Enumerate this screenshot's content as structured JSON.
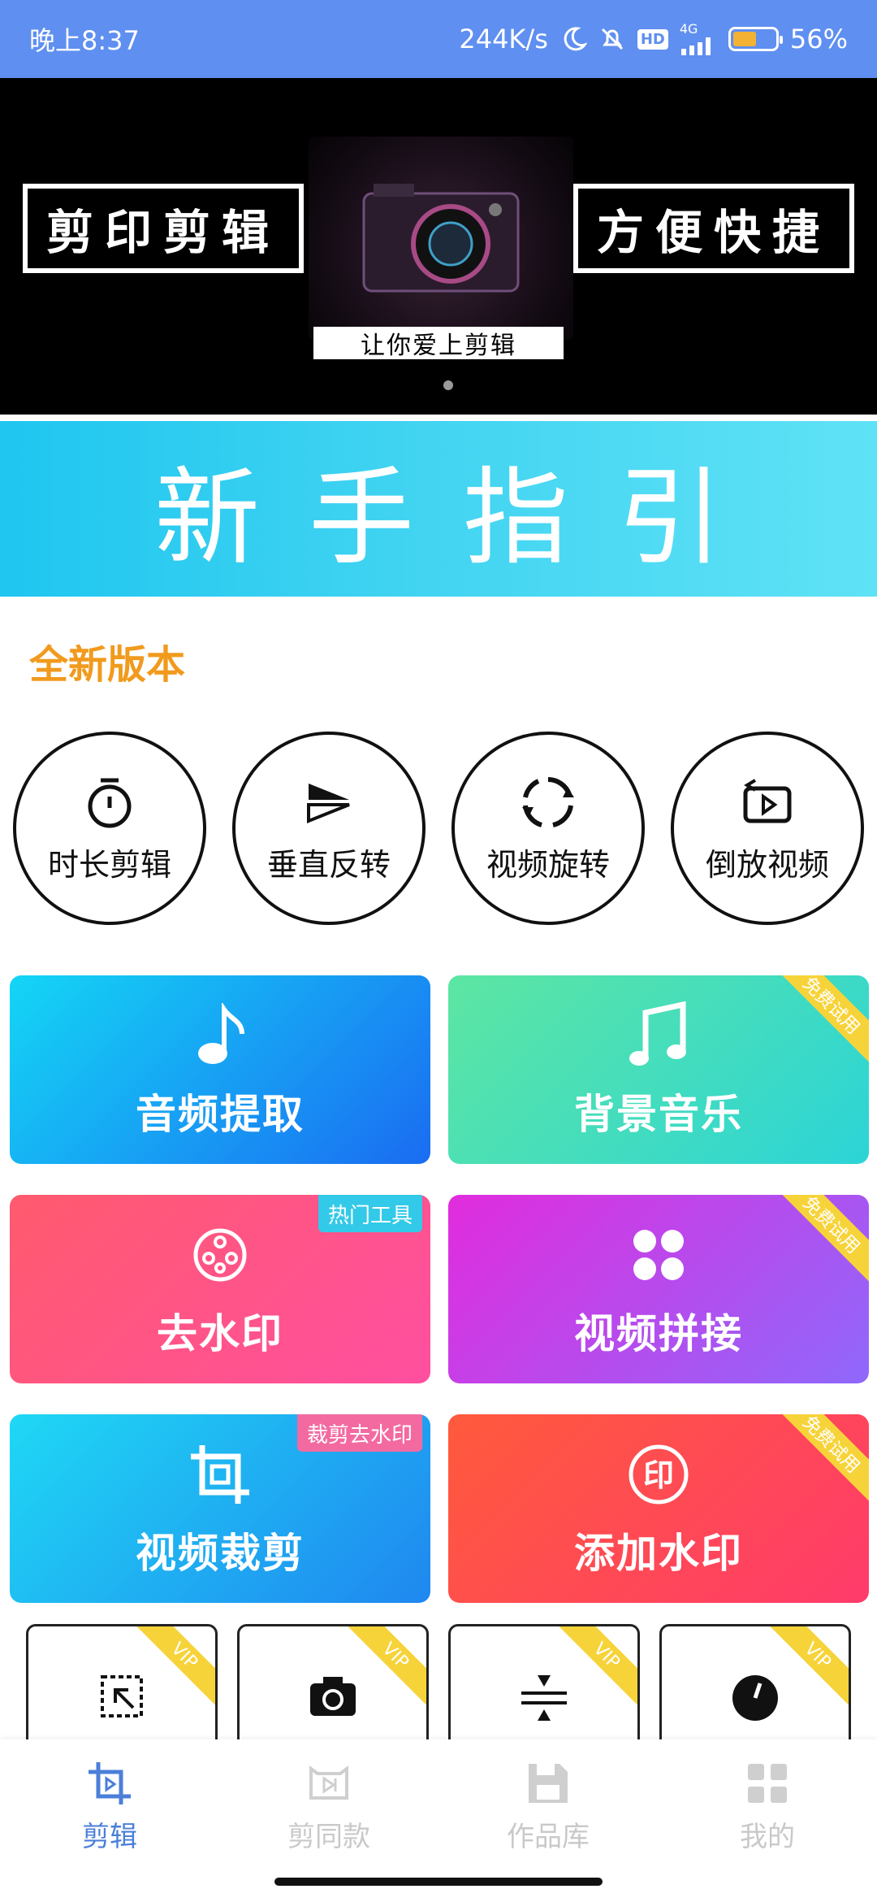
{
  "status_bar": {
    "time": "晚上8:37",
    "network_speed": "244K/s",
    "network_type": "4G",
    "hd_label": "HD",
    "battery": "56%",
    "battery_level": 0.56,
    "icons": [
      "moon-icon",
      "mute-bell-icon",
      "hd-icon",
      "signal-icon",
      "battery-icon"
    ]
  },
  "banner": {
    "left_text": "剪印剪辑",
    "right_text": "方便快捷",
    "tagline": "让你爱上剪辑",
    "pager_dots": 1
  },
  "guide": {
    "title": "新手指引"
  },
  "section": {
    "title": "全新版本"
  },
  "circle_tools": [
    {
      "label": "时长剪辑",
      "icon": "stopwatch-icon"
    },
    {
      "label": "垂直反转",
      "icon": "flip-icon"
    },
    {
      "label": "视频旋转",
      "icon": "rotate-icon"
    },
    {
      "label": "倒放视频",
      "icon": "reverse-video-icon"
    }
  ],
  "cards": [
    {
      "label": "音频提取",
      "icon": "music-note-icon",
      "badge": ""
    },
    {
      "label": "背景音乐",
      "icon": "music-notes-icon",
      "badge": "免费试用"
    },
    {
      "label": "去水印",
      "icon": "film-reel-icon",
      "badge": "热门工具"
    },
    {
      "label": "视频拼接",
      "icon": "four-petal-icon",
      "badge": "免费试用"
    },
    {
      "label": "视频裁剪",
      "icon": "crop-icon",
      "badge": "裁剪去水印"
    },
    {
      "label": "添加水印",
      "icon": "seal-icon",
      "badge": "免费试用"
    }
  ],
  "seal_glyph": "印",
  "vip_cards": [
    {
      "icon": "resize-icon",
      "badge": "VIP"
    },
    {
      "icon": "camera-rotate-icon",
      "badge": "VIP"
    },
    {
      "icon": "compress-icon",
      "badge": "VIP"
    },
    {
      "icon": "speedometer-icon",
      "badge": "VIP"
    }
  ],
  "bottom_nav": [
    {
      "label": "剪辑",
      "icon": "crop-play-icon",
      "active": true
    },
    {
      "label": "剪同款",
      "icon": "template-icon",
      "active": false
    },
    {
      "label": "作品库",
      "icon": "save-disk-icon",
      "active": false
    },
    {
      "label": "我的",
      "icon": "grid-icon",
      "active": false
    }
  ],
  "colors": {
    "status_bar": "#5f8ff0",
    "section_title": "#f19a1d",
    "active_nav": "#4b7fd9",
    "inactive_nav": "#c9c9c9",
    "badge_yellow": "#f7d33a"
  }
}
